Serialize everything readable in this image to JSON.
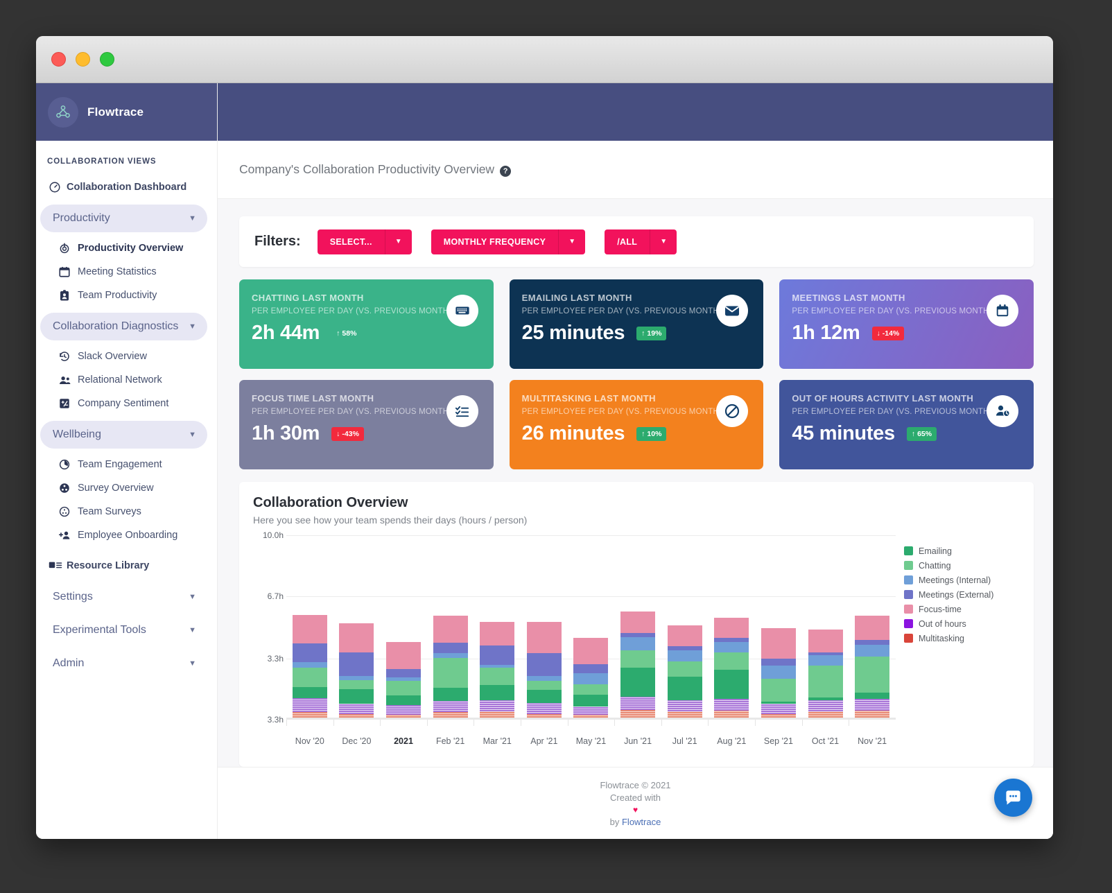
{
  "brand": {
    "name": "Flowtrace",
    "logo_icon": "flowtrace-logo-icon"
  },
  "sidebar": {
    "heading": "COLLABORATION VIEWS",
    "dashboard": {
      "label": "Collaboration Dashboard",
      "icon": "gauge-icon"
    },
    "groups": [
      {
        "label": "Productivity",
        "items": [
          {
            "label": "Productivity Overview",
            "icon": "target-icon",
            "active": true
          },
          {
            "label": "Meeting Statistics",
            "icon": "calendar-icon",
            "active": false
          },
          {
            "label": "Team Productivity",
            "icon": "badge-person-icon",
            "active": false
          }
        ]
      },
      {
        "label": "Collaboration Diagnostics",
        "items": [
          {
            "label": "Slack Overview",
            "icon": "clock-history-icon",
            "active": false
          },
          {
            "label": "Relational Network",
            "icon": "people-icon",
            "active": false
          },
          {
            "label": "Company Sentiment",
            "icon": "sentiment-icon",
            "active": false
          }
        ]
      },
      {
        "label": "Wellbeing",
        "items": [
          {
            "label": "Team Engagement",
            "icon": "pie-clock-icon",
            "active": false
          },
          {
            "label": "Survey Overview",
            "icon": "survey-filled-icon",
            "active": false
          },
          {
            "label": "Team Surveys",
            "icon": "survey-outline-icon",
            "active": false
          },
          {
            "label": "Employee Onboarding",
            "icon": "person-add-icon",
            "active": false
          }
        ]
      }
    ],
    "resource_library": {
      "label": "Resource Library",
      "icon": "library-icon"
    },
    "bottom_groups": [
      {
        "label": "Settings"
      },
      {
        "label": "Experimental Tools"
      },
      {
        "label": "Admin"
      }
    ],
    "chevron_icon": "chevron-down-icon"
  },
  "page": {
    "title": "Company's Collaboration Productivity Overview",
    "help_icon": "help-circle-icon",
    "help_glyph": "?"
  },
  "filters": {
    "label": "Filters:",
    "buttons": [
      {
        "label": "SELECT...",
        "caret_icon": "chevron-down-icon"
      },
      {
        "label": "MONTHLY FREQUENCY",
        "caret_icon": "chevron-down-icon"
      },
      {
        "label": "/ALL",
        "caret_icon": "chevron-down-icon"
      }
    ],
    "accent_color": "#f2125c"
  },
  "kpi_subtitle": "PER EMPLOYEE PER DAY (VS. PREVIOUS MONTH)",
  "kpi_cards": [
    {
      "title": "CHATTING LAST MONTH",
      "subtitle": "PER EMPLOYEE PER DAY (VS. PREVIOUS MONTH)",
      "value": "2h 44m",
      "delta": "58%",
      "delta_dir": "up",
      "delta_style": "flat",
      "arrow": "↑",
      "icon": "keyboard-icon",
      "bg": "#3ab389"
    },
    {
      "title": "EMAILING LAST MONTH",
      "subtitle": "PER EMPLOYEE PER DAY (VS. PREVIOUS MONTH)",
      "value": "25 minutes",
      "delta": "19%",
      "delta_dir": "up",
      "delta_style": "up",
      "arrow": "↑",
      "icon": "envelope-icon",
      "bg": "#0d3353"
    },
    {
      "title": "MEETINGS LAST MONTH",
      "subtitle": "PER EMPLOYEE PER DAY (VS. PREVIOUS MONTH)",
      "value": "1h 12m",
      "delta": "-14%",
      "delta_dir": "down",
      "delta_style": "down",
      "arrow": "↓",
      "icon": "calendar-icon",
      "bg": "linear-gradient(115deg,#6d7adb 0%,#8a5fc0 100%)"
    },
    {
      "title": "FOCUS TIME LAST MONTH",
      "subtitle": "PER EMPLOYEE PER DAY (VS. PREVIOUS MONTH)",
      "value": "1h 30m",
      "delta": "-43%",
      "delta_dir": "down",
      "delta_style": "down",
      "arrow": "↓",
      "icon": "checklist-icon",
      "bg": "#7c7f9e"
    },
    {
      "title": "MULTITASKING LAST MONTH",
      "subtitle": "PER EMPLOYEE PER DAY (VS. PREVIOUS MONTH)",
      "value": "26 minutes",
      "delta": "10%",
      "delta_dir": "up",
      "delta_style": "up",
      "arrow": "↑",
      "icon": "no-entry-icon",
      "bg": "#f3811e"
    },
    {
      "title": "OUT OF HOURS ACTIVITY LAST MONTH",
      "subtitle": "PER EMPLOYEE PER DAY (VS. PREVIOUS MONTH)",
      "value": "45 minutes",
      "delta": "65%",
      "delta_dir": "up",
      "delta_style": "up",
      "arrow": "↑",
      "icon": "person-clock-icon",
      "bg": "#41559b"
    }
  ],
  "chart_data": {
    "type": "bar",
    "stacked": true,
    "title": "Collaboration Overview",
    "subtitle": "Here you see how your team spends their days (hours / person)",
    "xlabel": "",
    "ylabel": "",
    "ylim": [
      0,
      10
    ],
    "grid": true,
    "legend_position": "right",
    "ytick_labels": [
      "10.0h",
      "6.7h",
      "3.3h",
      "3.3h"
    ],
    "ytick_values": [
      10.0,
      6.7,
      3.3,
      0
    ],
    "categories": [
      "Nov '20",
      "Dec '20",
      "2021",
      "Feb '21",
      "Mar '21",
      "Apr '21",
      "May '21",
      "Jun '21",
      "Jul '21",
      "Aug '21",
      "Sep '21",
      "Oct '21",
      "Nov '21"
    ],
    "bold_categories": [
      "2021"
    ],
    "series": [
      {
        "name": "Multitasking",
        "color": "#d9453a",
        "values": [
          0.42,
          0.3,
          0.26,
          0.4,
          0.44,
          0.3,
          0.28,
          0.52,
          0.44,
          0.5,
          0.3,
          0.44,
          0.5
        ]
      },
      {
        "name": "Out of hours",
        "color": "#8b13e0",
        "values": [
          0.74,
          0.56,
          0.52,
          0.6,
          0.62,
          0.6,
          0.45,
          0.72,
          0.6,
          0.62,
          0.55,
          0.6,
          0.62
        ]
      },
      {
        "name": "Emailing",
        "color": "#2cab6e",
        "values": [
          0.62,
          0.8,
          0.55,
          0.72,
          0.82,
          0.72,
          0.62,
          1.58,
          1.28,
          1.6,
          0.14,
          0.18,
          0.36
        ]
      },
      {
        "name": "Chatting",
        "color": "#6fcb8f",
        "values": [
          1.05,
          0.48,
          0.76,
          1.62,
          0.95,
          0.47,
          0.55,
          0.95,
          0.84,
          0.92,
          1.24,
          1.7,
          1.95
        ]
      },
      {
        "name": "Meetings (Internal)",
        "color": "#6f9fd8",
        "values": [
          0.3,
          0.24,
          0.19,
          0.27,
          0.15,
          0.28,
          0.62,
          0.72,
          0.6,
          0.58,
          0.7,
          0.56,
          0.62
        ]
      },
      {
        "name": "Meetings (External)",
        "color": "#6f74c8",
        "values": [
          1.0,
          1.26,
          0.46,
          0.58,
          1.04,
          1.26,
          0.48,
          0.2,
          0.24,
          0.2,
          0.38,
          0.18,
          0.26
        ]
      },
      {
        "name": "Focus-time",
        "color": "#e98fa8",
        "values": [
          1.55,
          1.58,
          1.48,
          1.45,
          1.3,
          1.68,
          1.42,
          1.18,
          1.1,
          1.12,
          1.66,
          1.22,
          1.34
        ]
      }
    ]
  },
  "footer": {
    "copyright": "Flowtrace © 2021",
    "created_with": "Created with",
    "heart": "♥",
    "by_prefix": "by ",
    "by_link": "Flowtrace"
  },
  "chat_widget": {
    "icon": "chat-bubble-icon"
  },
  "window_controls": {
    "close": "close-button",
    "minimize": "minimize-button",
    "maximize": "maximize-button"
  }
}
